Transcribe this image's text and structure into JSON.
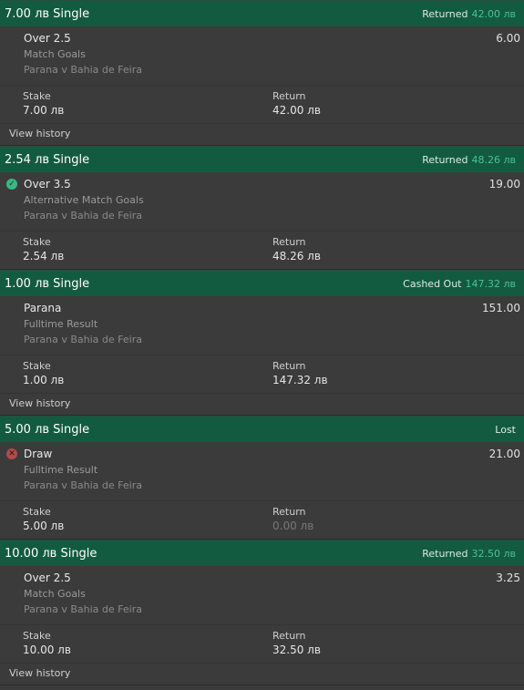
{
  "labels": {
    "stake": "Stake",
    "return": "Return",
    "view_history": "View history",
    "view_history_partial": "View history"
  },
  "bets": [
    {
      "title": "7.00 лв Single",
      "status": "Returned",
      "status_amount": "42.00 лв",
      "selection": "Over 2.5",
      "market": "Match Goals",
      "event": "Parana v Bahia de Feira",
      "odds": "6.00",
      "stake": "7.00 лв",
      "return": "42.00 лв"
    },
    {
      "title": "2.54 лв Single",
      "status": "Returned",
      "status_amount": "48.26 лв",
      "selection": "Over 3.5",
      "market": "Alternative Match Goals",
      "event": "Parana v Bahia de Feira",
      "odds": "19.00",
      "stake": "2.54 лв",
      "return": "48.26 лв"
    },
    {
      "title": "1.00 лв Single",
      "status": "Cashed Out",
      "status_amount": "147.32 лв",
      "selection": "Parana",
      "market": "Fulltime Result",
      "event": "Parana v Bahia de Feira",
      "odds": "151.00",
      "stake": "1.00 лв",
      "return": "147.32 лв"
    },
    {
      "title": "5.00 лв Single",
      "status": "Lost",
      "status_amount": "",
      "selection": "Draw",
      "market": "Fulltime Result",
      "event": "Parana v Bahia de Feira",
      "odds": "21.00",
      "stake": "5.00 лв",
      "return": "0.00 лв"
    },
    {
      "title": "10.00 лв Single",
      "status": "Returned",
      "status_amount": "32.50 лв",
      "selection": "Over 2.5",
      "market": "Match Goals",
      "event": "Parana v Bahia de Feira",
      "odds": "3.25",
      "stake": "10.00 лв",
      "return": "32.50 лв"
    }
  ],
  "icons": {
    "won": "check-circle-icon",
    "lost": "x-circle-icon"
  },
  "colors": {
    "header_bg": "#135b40",
    "amount_green": "#46c296",
    "won_icon": "#3bb784",
    "lost_icon": "#b34a4a"
  }
}
